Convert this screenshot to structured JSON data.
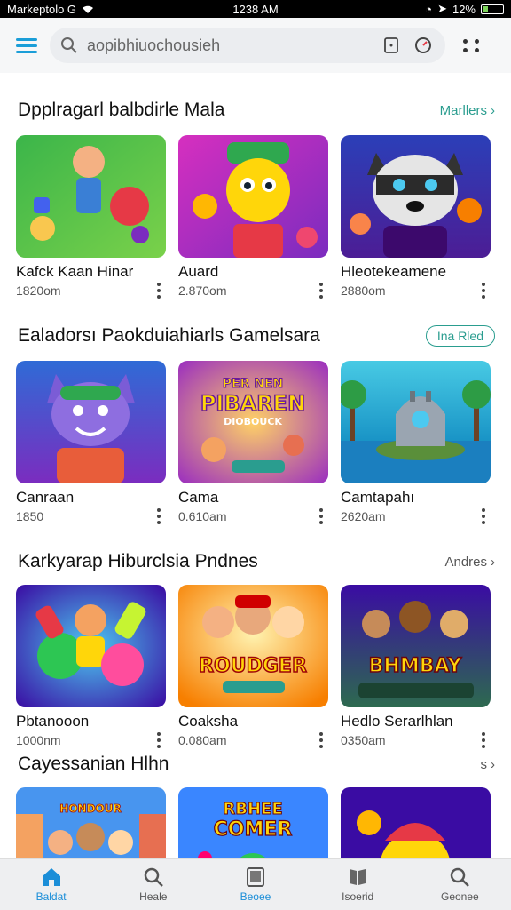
{
  "status": {
    "left_text": "Markeptolo G",
    "time": "1238 AM",
    "battery": "12%"
  },
  "search": {
    "placeholder": "aopibhiuochousieh"
  },
  "sections": [
    {
      "title": "Dpplragarl balbdirle Mala",
      "link": "Marllers",
      "cards": [
        {
          "title": "Kafck Kaan Hinar",
          "meta": "1820om",
          "icon": "cartoon-boy-thumbnail"
        },
        {
          "title": "Auard",
          "meta": "2.870om",
          "icon": "yellow-mascot-thumbnail"
        },
        {
          "title": "Hleotekeamene",
          "meta": "2880om",
          "icon": "raccoon-thumbnail"
        }
      ]
    },
    {
      "title": "Ealadorsı Paokduiahiarls Gamelsara",
      "link": "Ina Rled",
      "cards": [
        {
          "title": "Canraan",
          "meta": "1850",
          "icon": "purple-cat-thumbnail"
        },
        {
          "title": "Cama",
          "meta": "0.610am",
          "icon": "pibaren-thumbnail"
        },
        {
          "title": "Camtapahı",
          "meta": "2620am",
          "icon": "robot-island-thumbnail"
        }
      ]
    },
    {
      "title": "Karkyarap Hiburclsia Pndnes",
      "link": "Andres",
      "cards": [
        {
          "title": "Pbtanooon",
          "meta": "1000nm",
          "icon": "rainbow-blobs-thumbnail"
        },
        {
          "title": "Coaksha",
          "meta": "0.080am",
          "icon": "roudger-thumbnail"
        },
        {
          "title": "Hedlo Serarlhlan",
          "meta": "0350am",
          "icon": "bhmbay-thumbnail"
        }
      ]
    },
    {
      "title": "Cayessanian Hlhn",
      "link": "s",
      "cards": [
        {
          "title": "",
          "meta": "",
          "icon": "city-kids-thumbnail"
        },
        {
          "title": "",
          "meta": "",
          "icon": "comer-thumbnail"
        },
        {
          "title": "",
          "meta": "",
          "icon": "robot-face-thumbnail"
        }
      ]
    }
  ],
  "nav": [
    {
      "label": "Baldat",
      "icon": "home-icon"
    },
    {
      "label": "Heale",
      "icon": "search-icon"
    },
    {
      "label": "Beoee",
      "icon": "tablet-icon"
    },
    {
      "label": "Isoerid",
      "icon": "book-icon"
    },
    {
      "label": "Geonee",
      "icon": "search-icon"
    }
  ]
}
